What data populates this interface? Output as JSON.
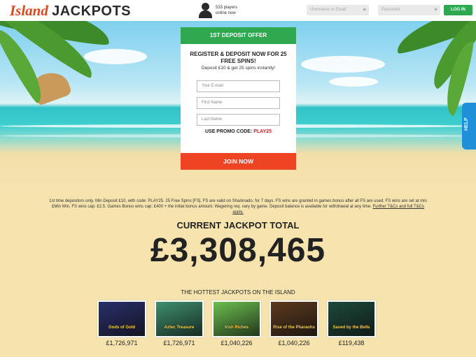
{
  "header": {
    "logo_island": "Island",
    "logo_jackpots": "JACKPOTS",
    "players_count": "533 players",
    "players_status": "online now",
    "username_placeholder": "Username or Email",
    "password_placeholder": "Password",
    "login_label": "LOG IN"
  },
  "offer": {
    "badge": "1ST DEPOSIT OFFER",
    "title": "REGISTER & DEPOSIT NOW FOR 25 FREE SPINS!",
    "subtitle": "Deposit £10 & get 25 spins instantly!",
    "email_placeholder": "Your E-mail",
    "firstname_placeholder": "First Name",
    "lastname_placeholder": "Last Name",
    "promo_label": "USE PROMO CODE:",
    "promo_code": "PLAY25",
    "join_label": "JOIN NOW"
  },
  "help_label": "HELP",
  "terms": {
    "text": "1st time depositors only. Min Deposit £10, with code: PLAY25. 25 Free Spins [FS]. FS are valid on Sharknado, for 7 days. FS wins are granted in games bonus after all FS are used. FS wins are set at min £Min Win. FS wins cap: £2.5. Games Bonus wins cap: £400 + the initial bonus amount. Wagering req. vary by game. Deposit balance is available for withdrawal at any time.",
    "link": "Further T&Cs and full T&Cs apply."
  },
  "jackpot": {
    "title": "CURRENT JACKPOT TOTAL",
    "amount": "£3,308,465"
  },
  "hottest_title": "THE HOTTEST JACKPOTS ON THE ISLAND",
  "games": [
    {
      "name": "Gods of Gold",
      "amount": "£1,726,971",
      "color": "#2a2f6b"
    },
    {
      "name": "Aztec Treasure",
      "amount": "£1,726,971",
      "color": "#3e8f6e"
    },
    {
      "name": "Irish Riches",
      "amount": "£1,040,226",
      "color": "#6cbf4f"
    },
    {
      "name": "Rise of the Pharaohs",
      "amount": "£1,040,226",
      "color": "#5c3a1e"
    },
    {
      "name": "Saved by the Bells",
      "amount": "£119,438",
      "color": "#1d4a3a"
    }
  ],
  "colors": {
    "brand_green": "#2fa84f",
    "join_orange": "#ee4423",
    "help_blue": "#1e8fd8",
    "promo_red": "#d21f26"
  }
}
